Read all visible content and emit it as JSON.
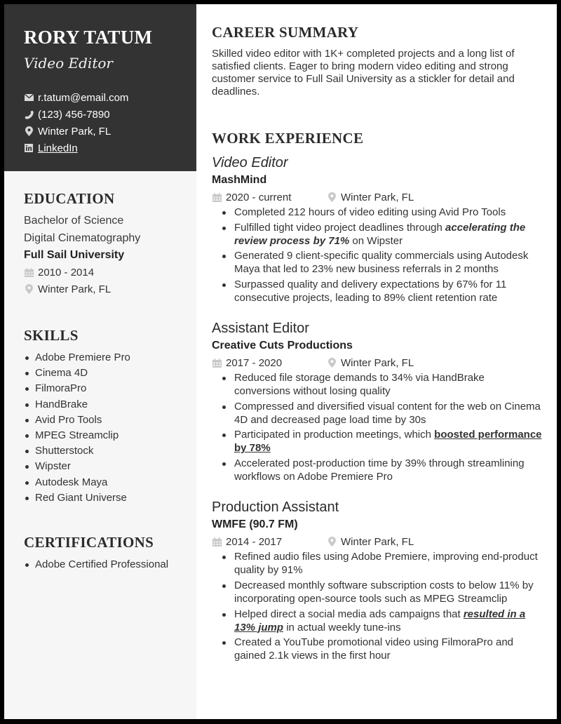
{
  "header": {
    "name": "RORY TATUM",
    "title": "Video Editor",
    "contacts": {
      "email": {
        "icon": "envelope-icon",
        "text": "r.tatum@email.com"
      },
      "phone": {
        "icon": "phone-icon",
        "text": "(123) 456-7890"
      },
      "location": {
        "icon": "map-pin-icon",
        "text": "Winter Park, FL"
      },
      "linkedin": {
        "icon": "linkedin-icon",
        "text": "LinkedIn"
      }
    }
  },
  "education": {
    "heading": "EDUCATION",
    "degree": "Bachelor of Science",
    "field": "Digital Cinematography",
    "school": "Full Sail University",
    "dates": "2010 - 2014",
    "location": "Winter Park, FL"
  },
  "skills": {
    "heading": "SKILLS",
    "items": [
      "Adobe Premiere Pro",
      "Cinema 4D",
      "FilmoraPro",
      "HandBrake",
      "Avid Pro Tools",
      "MPEG Streamclip",
      "Shutterstock",
      "Wipster",
      "Autodesk Maya",
      "Red Giant Universe"
    ]
  },
  "certifications": {
    "heading": "CERTIFICATIONS",
    "items": [
      "Adobe Certified Professional"
    ]
  },
  "career_summary": {
    "heading": "CAREER SUMMARY",
    "text": "Skilled video editor with 1K+ completed projects and a long list of satisfied clients. Eager to bring modern video editing and strong customer service to Full Sail University as a stickler for detail and deadlines."
  },
  "work_experience": {
    "heading": "WORK EXPERIENCE",
    "jobs": [
      {
        "title": "Video Editor",
        "company": "MashMind",
        "dates": "2020 - current",
        "location": "Winter Park, FL",
        "bullets": [
          {
            "pre": "Completed 212 hours of video editing using Avid Pro Tools",
            "emph": "",
            "post": ""
          },
          {
            "pre": "Fulfilled tight video project deadlines through ",
            "emph": "accelerating the review process by 71%",
            "post": " on Wipster"
          },
          {
            "pre": "Generated 9 client-specific quality commercials using Autodesk Maya that led to 23% new business referrals in 2 months",
            "emph": "",
            "post": ""
          },
          {
            "pre": "Surpassed quality and delivery expectations by 67% for 11 consecutive projects, leading to 89% client retention rate",
            "emph": "",
            "post": ""
          }
        ]
      },
      {
        "title": "Assistant Editor",
        "company": "Creative Cuts Productions",
        "dates": "2017 - 2020",
        "location": "Winter Park, FL",
        "bullets": [
          {
            "pre": "Reduced file storage demands to 34% via HandBrake conversions without losing quality",
            "emph": "",
            "post": ""
          },
          {
            "pre": "Compressed and diversified visual content for the web on Cinema 4D and decreased page load time by 30s",
            "emph": "",
            "post": ""
          },
          {
            "pre": "Participated in production meetings, which ",
            "emph": "boosted performance by 78%",
            "post": ""
          },
          {
            "pre": "Accelerated post-production time by 39% through streamlining workflows on Adobe Premiere Pro",
            "emph": "",
            "post": ""
          }
        ]
      },
      {
        "title": "Production Assistant",
        "company": "WMFE (90.7 FM)",
        "dates": "2014 - 2017",
        "location": "Winter Park, FL",
        "bullets": [
          {
            "pre": "Refined audio files using Adobe Premiere, improving end-product quality by 91%",
            "emph": "",
            "post": ""
          },
          {
            "pre": "Decreased monthly software subscription costs to below 11% by incorporating open-source tools such as MPEG Streamclip",
            "emph": "",
            "post": ""
          },
          {
            "pre": "Helped direct a social media ads campaigns that ",
            "emph": "resulted in a 13% jump",
            "post": " in actual weekly tune-ins"
          },
          {
            "pre": "Created a YouTube promotional video using FilmoraPro and gained 2.1k views in the first hour",
            "emph": "",
            "post": ""
          }
        ]
      }
    ]
  },
  "colors": {
    "sidebar_header_bg": "#333333",
    "sidebar_bg": "#f6f6f6",
    "text": "#333333",
    "icon_gray": "#bdbdbd"
  }
}
